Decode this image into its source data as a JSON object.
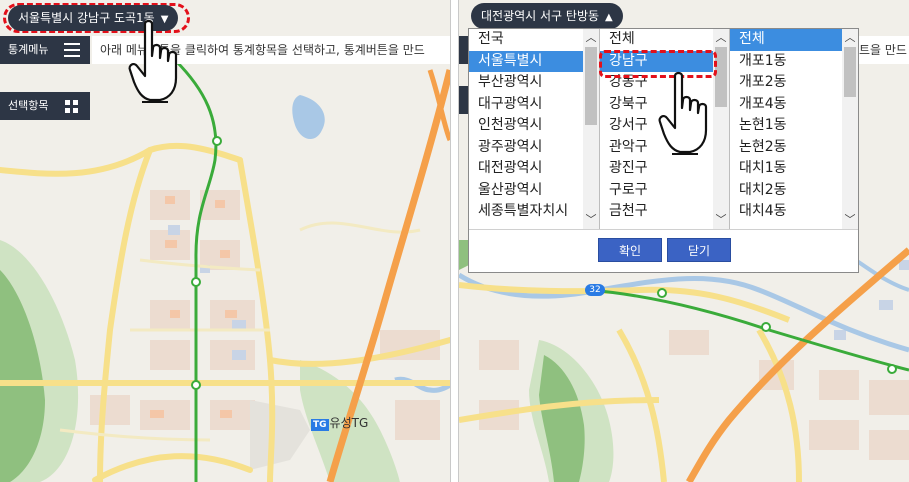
{
  "colors": {
    "accent": "#2d3645",
    "highlight_red": "#e3101a",
    "selection_blue": "#3c8de0",
    "dialog_button": "#3b63c4",
    "map_bg": "#f1efe9",
    "road_yellow": "#f7e08a",
    "road_orange": "#f5a04a",
    "rail_green": "#3aab3a",
    "water": "#a9c8e6",
    "park": "#7ab36a"
  },
  "left": {
    "region_pill": {
      "label": "서울특별시 강남구 도곡1동",
      "arrow": "▼"
    },
    "stats_menu": {
      "label": "통계메뉴",
      "icon": "hamburger-icon"
    },
    "select_item": {
      "label": "선택항목",
      "icon": "grid-icon"
    },
    "hint_text": "아래 메뉴버튼을 클릭하여 통계항목을 선택하고, 통계버튼을 만드",
    "map_label": {
      "badge": "TG",
      "text": "유성TG"
    }
  },
  "right": {
    "region_pill": {
      "label": "대전광역시 서구 탄방동",
      "arrow": "▲"
    },
    "hint_text": "트을 만드",
    "route_badge": "32",
    "dialog": {
      "col1": [
        "전국",
        "서울특별시",
        "부산광역시",
        "대구광역시",
        "인천광역시",
        "광주광역시",
        "대전광역시",
        "울산광역시",
        "세종특별자치시"
      ],
      "col1_selected": 1,
      "col2": [
        "전체",
        "강남구",
        "강동구",
        "강북구",
        "강서구",
        "관악구",
        "광진구",
        "구로구",
        "금천구"
      ],
      "col2_selected": 1,
      "col3": [
        "전체",
        "개포1동",
        "개포2동",
        "개포4동",
        "논현1동",
        "논현2동",
        "대치1동",
        "대치2동",
        "대치4동"
      ],
      "col3_selected": 0,
      "confirm_label": "확인",
      "close_label": "닫기"
    }
  }
}
